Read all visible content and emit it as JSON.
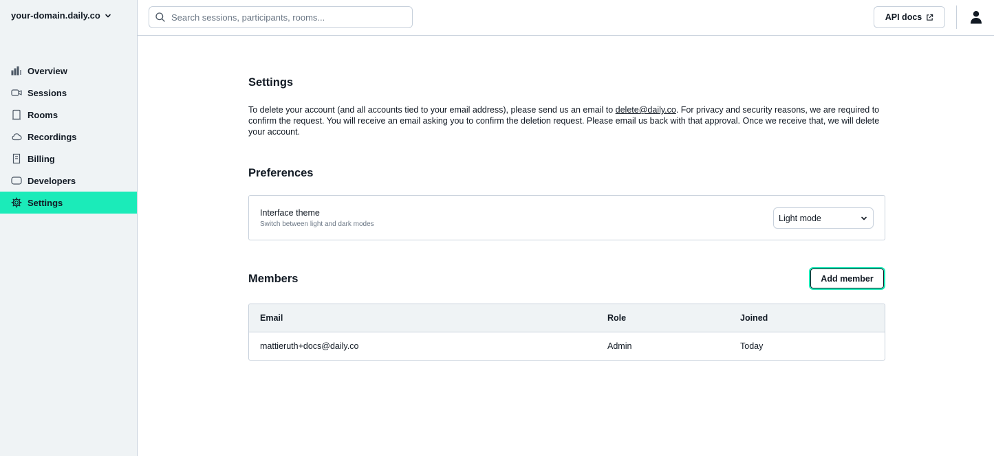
{
  "sidebar": {
    "domain": "your-domain.daily.co",
    "items": [
      {
        "label": "Overview",
        "icon": "bar-chart-icon"
      },
      {
        "label": "Sessions",
        "icon": "video-camera-icon"
      },
      {
        "label": "Rooms",
        "icon": "door-icon"
      },
      {
        "label": "Recordings",
        "icon": "cloud-icon"
      },
      {
        "label": "Billing",
        "icon": "receipt-icon"
      },
      {
        "label": "Developers",
        "icon": "terminal-icon"
      },
      {
        "label": "Settings",
        "icon": "gear-icon",
        "active": true
      }
    ]
  },
  "topbar": {
    "search_placeholder": "Search sessions, participants, rooms...",
    "api_docs_label": "API docs"
  },
  "settings": {
    "title": "Settings",
    "text_before": "To delete your account (and all accounts tied to your email address), please send us an email to ",
    "email_link": "delete@daily.co",
    "text_after": ". For privacy and security reasons, we are required to confirm the request. You will receive an email asking you to confirm the deletion request. Please email us back with that approval. Once we receive that, we will delete your account."
  },
  "preferences": {
    "title": "Preferences",
    "theme_label": "Interface theme",
    "theme_sub": "Switch between light and dark modes",
    "theme_value": "Light mode"
  },
  "members": {
    "title": "Members",
    "add_label": "Add member",
    "columns": [
      "Email",
      "Role",
      "Joined"
    ],
    "rows": [
      {
        "email": "mattieruth+docs@daily.co",
        "role": "Admin",
        "joined": "Today"
      }
    ]
  },
  "colors": {
    "accent": "#1bebb9",
    "sidebar_bg": "#eff3f5",
    "border": "#c8d1dc",
    "text": "#121a24"
  }
}
